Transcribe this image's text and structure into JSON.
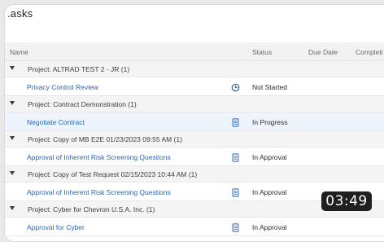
{
  "page": {
    "title": ".asks"
  },
  "columns": {
    "name": "Name",
    "status": "Status",
    "due_date": "Due Date",
    "completion": "Completi"
  },
  "groups": [
    {
      "label": "Project: ALTRAD TEST 2 - JR  (1)",
      "task": {
        "name": "Privacy Control Review",
        "icon": "clock-icon",
        "status": "Not Started",
        "selected": false
      }
    },
    {
      "label": "Project: Contract Demonstration  (1)",
      "task": {
        "name": "Negotiate Contract",
        "icon": "document-icon",
        "status": "In Progress",
        "selected": true
      }
    },
    {
      "label": "Project: Copy of MB E2E 01/23/2023 09:55 AM  (1)",
      "task": {
        "name": "Approval of Inherent Risk Screening Questions",
        "icon": "document-icon",
        "status": "In Approval",
        "selected": false
      }
    },
    {
      "label": "Project: Copy of Test Request 02/15/2023 10:44 AM  (1)",
      "task": {
        "name": "Approval of Inherent Risk Screening Questions",
        "icon": "document-icon",
        "status": "In Approval",
        "selected": false
      }
    },
    {
      "label": "Project: Cyber for Chevron U.S.A. Inc.  (1)",
      "task": {
        "name": "Approval for Cyber",
        "icon": "document-icon",
        "status": "In Approval",
        "selected": false
      }
    }
  ],
  "overlay": {
    "timer": "03:49"
  },
  "colors": {
    "link": "#2965b1",
    "icon": "#2965b1",
    "group_bg": "#f4f4f4",
    "selected_bg": "#eef4fb"
  }
}
